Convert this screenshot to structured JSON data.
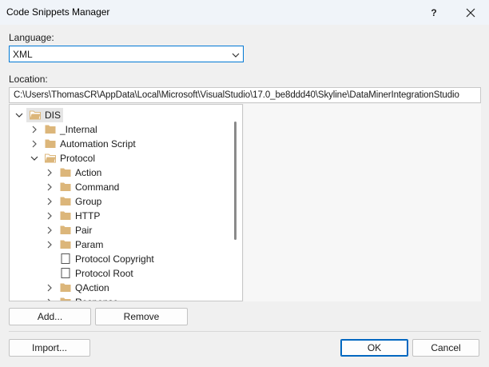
{
  "window": {
    "title": "Code Snippets Manager",
    "help_glyph": "?",
    "close_glyph": "✕"
  },
  "language": {
    "label": "Language:",
    "selected": "XML"
  },
  "location": {
    "label": "Location:",
    "path": "C:\\Users\\ThomasCR\\AppData\\Local\\Microsoft\\VisualStudio\\17.0_be8ddd40\\Skyline\\DataMinerIntegrationStudio"
  },
  "tree": {
    "items": [
      {
        "label": "DIS",
        "expanded": true,
        "kind": "folder-open",
        "selected": true
      },
      {
        "label": "_Internal",
        "expanded": false,
        "kind": "folder"
      },
      {
        "label": "Automation Script",
        "expanded": false,
        "kind": "folder"
      },
      {
        "label": "Protocol",
        "expanded": true,
        "kind": "folder-open"
      },
      {
        "label": "Action",
        "expanded": false,
        "kind": "folder"
      },
      {
        "label": "Command",
        "expanded": false,
        "kind": "folder"
      },
      {
        "label": "Group",
        "expanded": false,
        "kind": "folder"
      },
      {
        "label": "HTTP",
        "expanded": false,
        "kind": "folder"
      },
      {
        "label": "Pair",
        "expanded": false,
        "kind": "folder"
      },
      {
        "label": "Param",
        "expanded": false,
        "kind": "folder"
      },
      {
        "label": "Protocol Copyright",
        "kind": "snippet"
      },
      {
        "label": "Protocol Root",
        "kind": "snippet"
      },
      {
        "label": "QAction",
        "expanded": false,
        "kind": "folder"
      },
      {
        "label": "Response",
        "expanded": false,
        "kind": "folder"
      }
    ]
  },
  "buttons": {
    "add": "Add...",
    "remove": "Remove",
    "import": "Import...",
    "ok": "OK",
    "cancel": "Cancel"
  },
  "colors": {
    "folder": "#dcb67a",
    "accent": "#0067c0"
  }
}
